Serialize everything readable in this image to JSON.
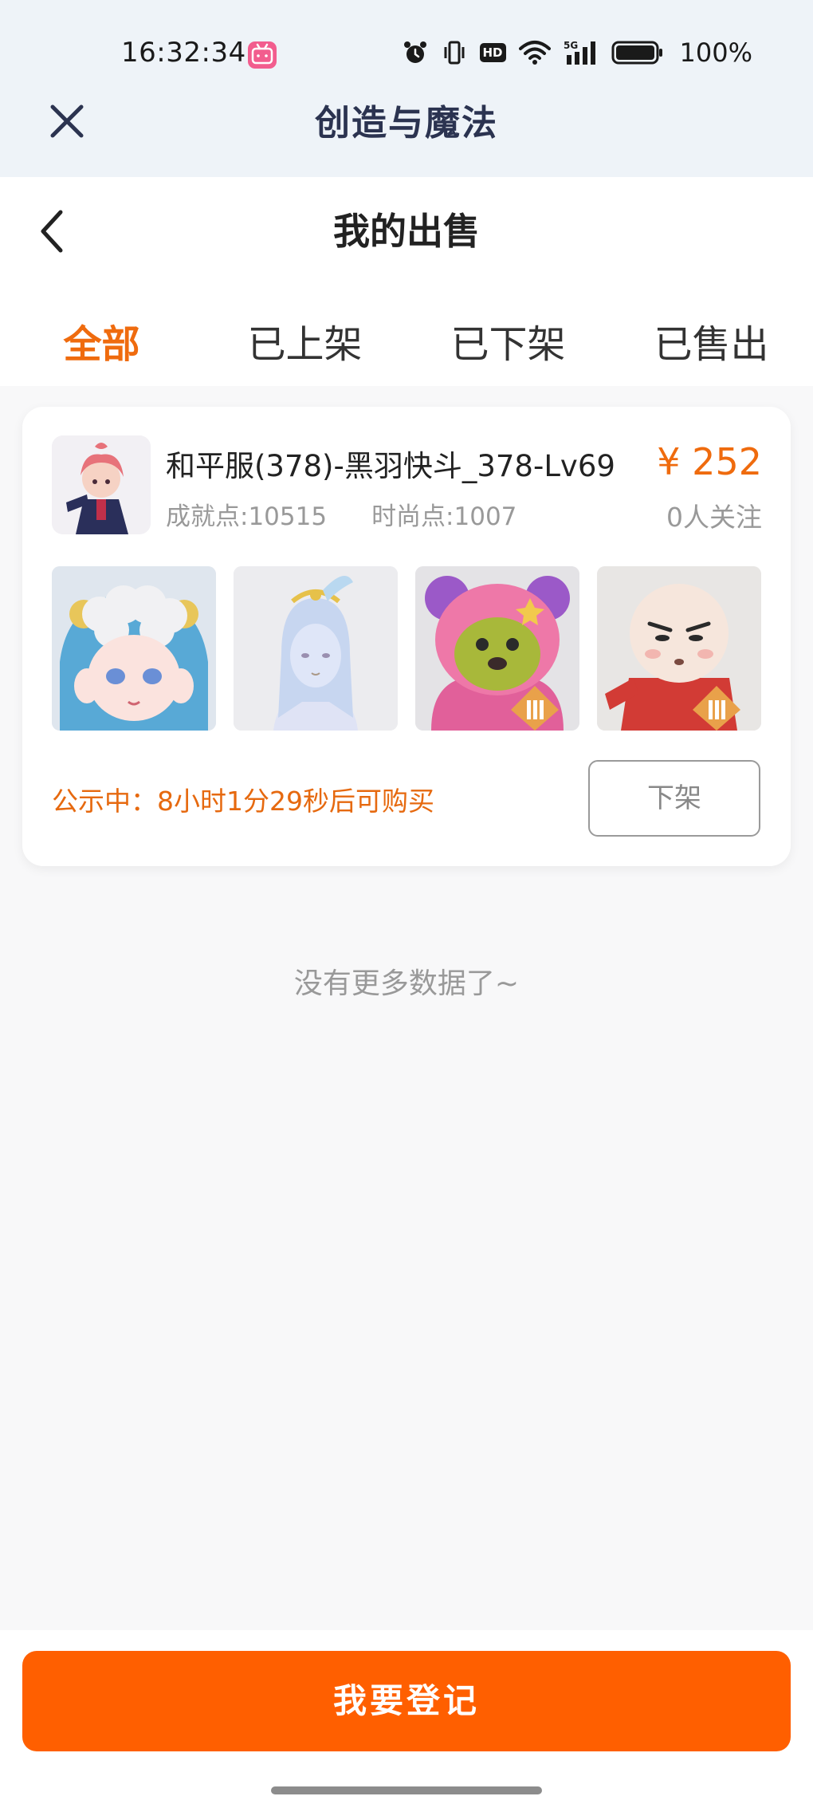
{
  "status": {
    "time": "16:32:34",
    "app_badge": "bilibili",
    "battery": "100%",
    "hd": "HD",
    "network": "5G"
  },
  "appbar": {
    "title": "创造与魔法"
  },
  "page": {
    "title": "我的出售"
  },
  "tabs": [
    {
      "label": "全部",
      "active": true
    },
    {
      "label": "已上架",
      "active": false
    },
    {
      "label": "已下架",
      "active": false
    },
    {
      "label": "已售出",
      "active": false
    }
  ],
  "listing": {
    "title": "和平服(378)-黑羽快斗_378-Lv69",
    "achievement": "成就点:10515",
    "fashion": "时尚点:1007",
    "price": "¥ 252",
    "followers": "0人关注",
    "notice": "公示中：8小时1分29秒后可购买",
    "delist_label": "下架",
    "gallery": [
      "sheep-hood-avatar",
      "white-spirit-avatar",
      "pink-bear-avatar",
      "bald-boy-avatar"
    ]
  },
  "no_more_text": "没有更多数据了~",
  "register_label": "我要登记",
  "colors": {
    "accent": "#ef6b0e",
    "button": "#ff5f00",
    "appbar_bg": "#eef3f8",
    "title_color": "#2b3350"
  }
}
